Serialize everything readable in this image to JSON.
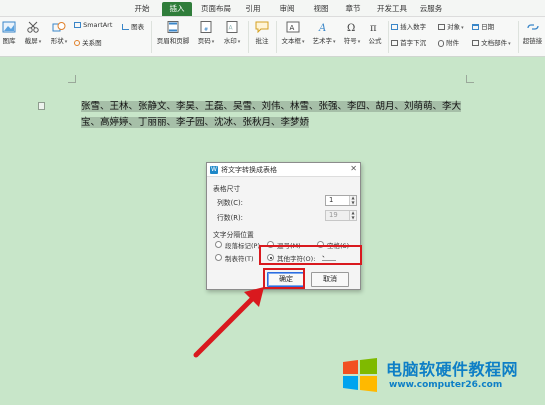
{
  "tabs": [
    {
      "label": "开始",
      "active": false
    },
    {
      "label": "插入",
      "active": true
    },
    {
      "label": "页面布局",
      "active": false
    },
    {
      "label": "引用",
      "active": false
    },
    {
      "label": "审阅",
      "active": false
    },
    {
      "label": "视图",
      "active": false
    },
    {
      "label": "章节",
      "active": false
    },
    {
      "label": "开发工具",
      "active": false
    },
    {
      "label": "云服务",
      "active": false
    }
  ],
  "ribbon": {
    "picture": "图库",
    "screenshot": "截屏",
    "shape": "形状",
    "smartart": "SmartArt",
    "chart": "图表",
    "relation": "关系图",
    "header_footer": "页眉和页脚",
    "page_number": "页码",
    "watermark": "水印",
    "comment": "批注",
    "textbox": "文本框",
    "wordart": "艺术字",
    "symbol": "符号",
    "formula": "公式",
    "insert_number": "插入数字",
    "object": "对象",
    "date": "日期",
    "first_drop": "首字下沉",
    "attachment": "附件",
    "doc_parts": "文档部件",
    "hyperlink": "超链接"
  },
  "document": {
    "line1": "张雪、王林、张静文、李昊、王磊、吴雪、刘伟、林雪、张强、李四、胡月、刘萌萌、李大",
    "line2": "宝、高婷婷、丁丽丽、李子园、沈冰、张秋月、李梦娇"
  },
  "dialog": {
    "title": "将文字转换成表格",
    "close": "✕",
    "table_size_label": "表格尺寸",
    "columns_label": "列数(C):",
    "columns_value": "1",
    "rows_label": "行数(R):",
    "rows_value": "19",
    "separator_label": "文字分隔位置",
    "opt_paragraph": "段落标记(P)",
    "opt_comma": "逗号(M)",
    "opt_space": "空格(S)",
    "opt_tab": "制表符(T)",
    "opt_other": "其他字符(O):",
    "other_value": "、",
    "ok": "确定",
    "cancel": "取消"
  },
  "watermark": {
    "title": "电脑软硬件教程网",
    "url": "www.computer26.com"
  },
  "colors": {
    "accent": "#2f7d3a",
    "doc_bg": "#c8e6c9",
    "highlight_red": "#d9191e",
    "selection": "#a6bfa8",
    "brand_blue": "#0e7fc6"
  }
}
